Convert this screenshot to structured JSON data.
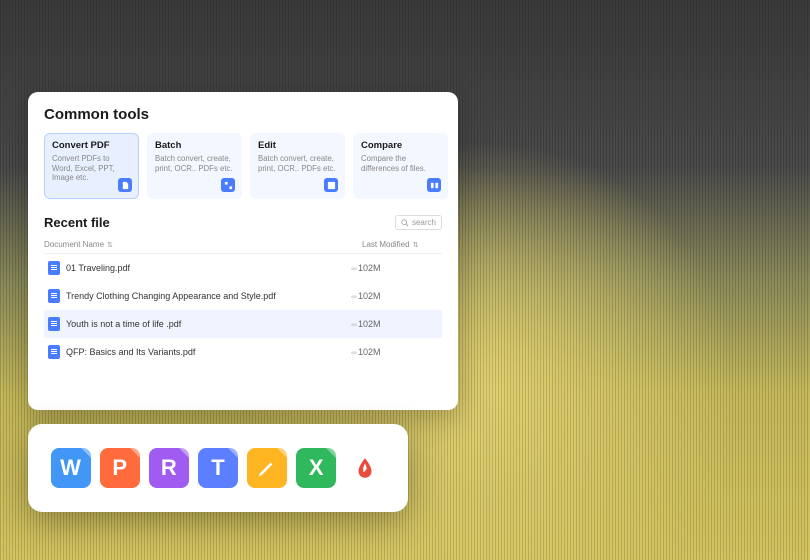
{
  "panel": {
    "heading": "Common tools",
    "tools": [
      {
        "title": "Convert PDF",
        "desc": "Convert PDFs to Word, Excel, PPT, Image etc."
      },
      {
        "title": "Batch",
        "desc": "Batch convert, create, print, OCR.. PDFs etc."
      },
      {
        "title": "Edit",
        "desc": "Batch convert, create, print, OCR.. PDFs etc."
      },
      {
        "title": "Compare",
        "desc": "Compare the differences of files."
      }
    ],
    "recent": {
      "title": "Recent file",
      "search_placeholder": "search",
      "columns": {
        "name": "Document Name",
        "modified": "Last Modified"
      },
      "files": [
        {
          "name": "01 Traveling.pdf",
          "size": "102M"
        },
        {
          "name": "Trendy Clothing Changing Appearance and Style.pdf",
          "size": "102M"
        },
        {
          "name": "Youth is not a time of life .pdf",
          "size": "102M"
        },
        {
          "name": "QFP: Basics and Its Variants.pdf",
          "size": "102M"
        }
      ]
    }
  },
  "strip": {
    "icons": [
      "W",
      "P",
      "R",
      "T",
      "pencil",
      "X",
      "pdf"
    ]
  }
}
